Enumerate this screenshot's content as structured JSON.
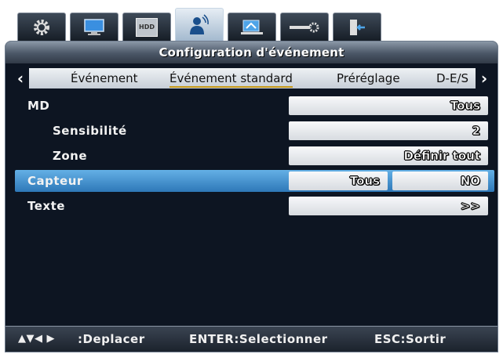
{
  "top_tabs": [
    {
      "icon": "gear-icon"
    },
    {
      "icon": "monitor-icon"
    },
    {
      "icon": "hdd-icon",
      "label": "HDD"
    },
    {
      "icon": "person-alarm-icon",
      "active": true
    },
    {
      "icon": "network-icon"
    },
    {
      "icon": "slider-gear-icon"
    },
    {
      "icon": "exit-icon"
    }
  ],
  "window": {
    "title": "Configuration d'événement"
  },
  "nav": {
    "left_arrow": "‹",
    "right_arrow": "›",
    "tabs": [
      "Événement",
      "Événement standard",
      "Préréglage",
      "D-E/S"
    ],
    "active_tab": "Événement standard"
  },
  "rows": {
    "md": {
      "label": "MD",
      "value": "Tous"
    },
    "sensibilite": {
      "label": "Sensibilité",
      "value": "2"
    },
    "zone": {
      "label": "Zone",
      "value": "Définir tout"
    },
    "capteur": {
      "label": "Capteur",
      "value1": "Tous",
      "value2": "NO"
    },
    "texte": {
      "label": "Texte",
      "value": ">>"
    }
  },
  "footer": {
    "move_keys": "▲▼◀ ▶",
    "move": ":Deplacer",
    "enter": "ENTER:Selectionner",
    "esc": "ESC:Sortir"
  },
  "colors": {
    "selected_row": "#3f8fd0",
    "frame_bg": "#0d1522",
    "active_tab_underline": "#c79a18"
  }
}
